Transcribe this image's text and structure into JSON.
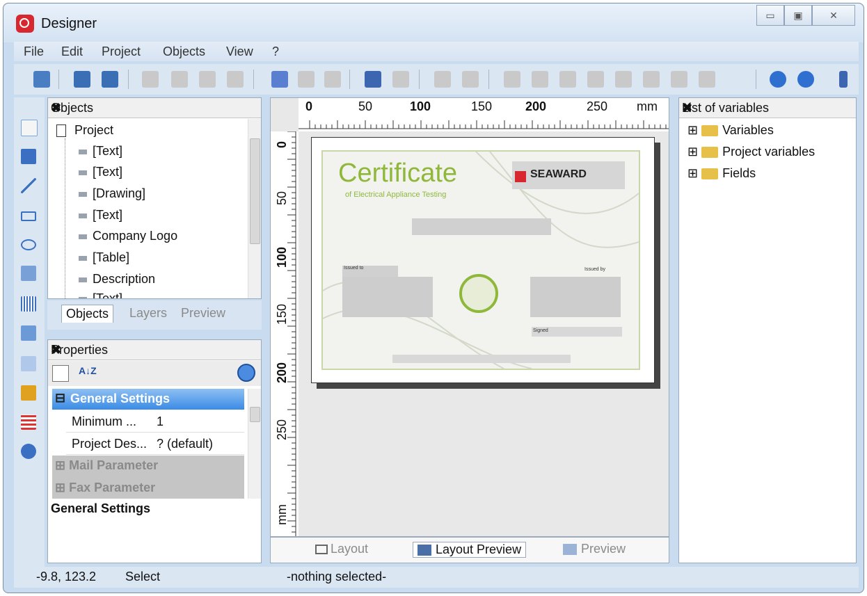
{
  "window": {
    "title": "Designer"
  },
  "menu": [
    "File",
    "Edit",
    "Project",
    "Objects",
    "View",
    "?"
  ],
  "objects_panel": {
    "title": "Objects",
    "close": "✖",
    "root": "Project",
    "items": [
      "[Text]",
      "[Text]",
      "[Drawing]",
      "[Text]",
      "Company Logo",
      "[Table]",
      "Description",
      "[Text]"
    ],
    "tabs": [
      "Objects",
      "Layers",
      "Preview"
    ]
  },
  "properties_panel": {
    "title": "Properties",
    "close": "✖",
    "sort_glyph": "A↓Z",
    "section": "General Settings",
    "rows": [
      {
        "name": "Minimum ...",
        "value": "1"
      },
      {
        "name": "Project Des...",
        "value": "? (default)"
      }
    ],
    "collapsed": [
      "Mail Parameter",
      "Fax Parameter"
    ],
    "description": "General Settings",
    "expander_minus": "⊟",
    "expander_plus": "⊞"
  },
  "ruler": {
    "top_labels": [
      "0",
      "50",
      "100",
      "150",
      "200",
      "250",
      "mm"
    ],
    "left_labels": [
      "0",
      "50",
      "100",
      "150",
      "200",
      "250",
      "mm"
    ]
  },
  "certificate": {
    "title": "Certificate",
    "subtitle": "of Electrical Appliance Testing",
    "brand": "SEAWARD",
    "issued_to": "Issued to",
    "issued_by": "Issued by",
    "signed": "Signed"
  },
  "bottom_tabs": [
    "Layout",
    "Layout Preview",
    "Preview"
  ],
  "variables_panel": {
    "title": "List of variables",
    "close": "✖",
    "items": [
      "Variables",
      "Project variables",
      "Fields"
    ]
  },
  "status": {
    "coords": "-9.8, 123.2",
    "mode": "Select",
    "selection": "-nothing selected-"
  },
  "colors": {
    "accent": "#3399ff",
    "cert_green": "#8fb83a",
    "brand_red": "#d6282e"
  }
}
